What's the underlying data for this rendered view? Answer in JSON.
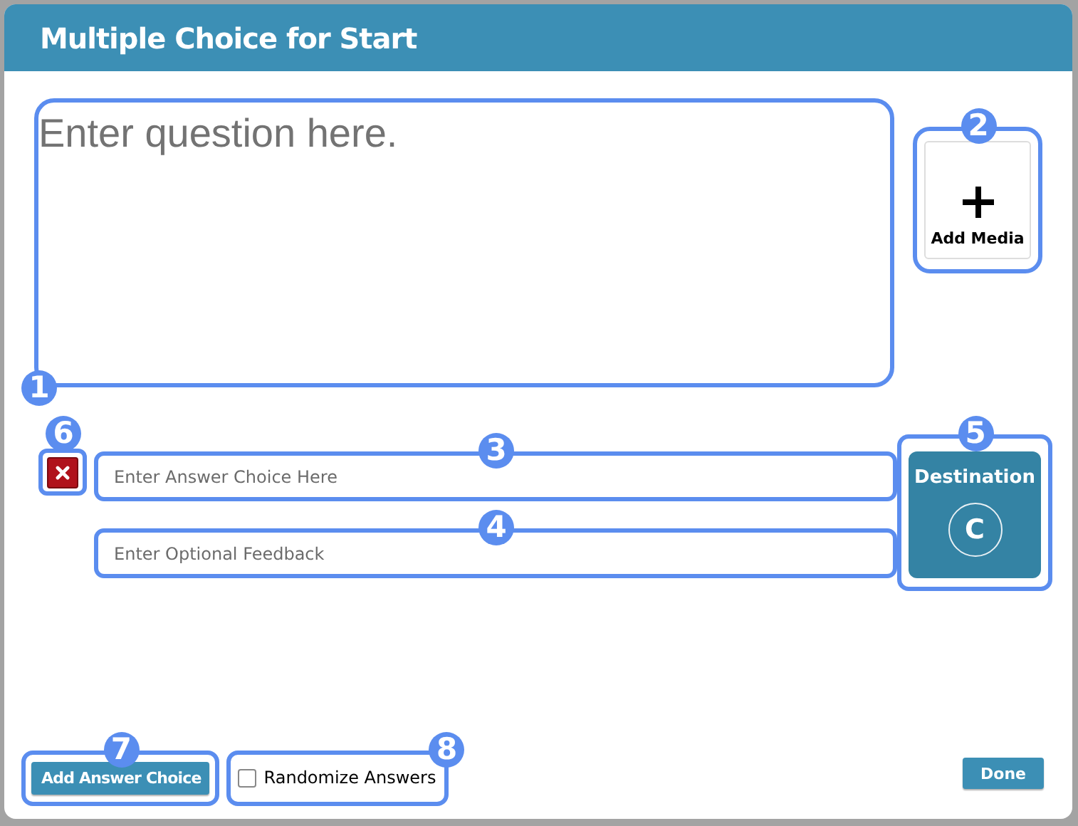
{
  "dialog": {
    "title": "Multiple Choice for Start"
  },
  "question": {
    "placeholder": "Enter question here.",
    "callout": "1"
  },
  "add_media": {
    "label": "Add Media",
    "callout": "2"
  },
  "delete_answer": {
    "callout": "6"
  },
  "answer": {
    "placeholder": "Enter Answer Choice Here",
    "callout": "3"
  },
  "feedback": {
    "placeholder": "Enter Optional Feedback",
    "callout": "4"
  },
  "destination": {
    "label": "Destination",
    "value": "C",
    "callout": "5"
  },
  "add_answer": {
    "label": "Add Answer Choice",
    "callout": "7"
  },
  "randomize": {
    "label": "Randomize Answers",
    "checked": false,
    "callout": "8"
  },
  "done": {
    "label": "Done"
  }
}
